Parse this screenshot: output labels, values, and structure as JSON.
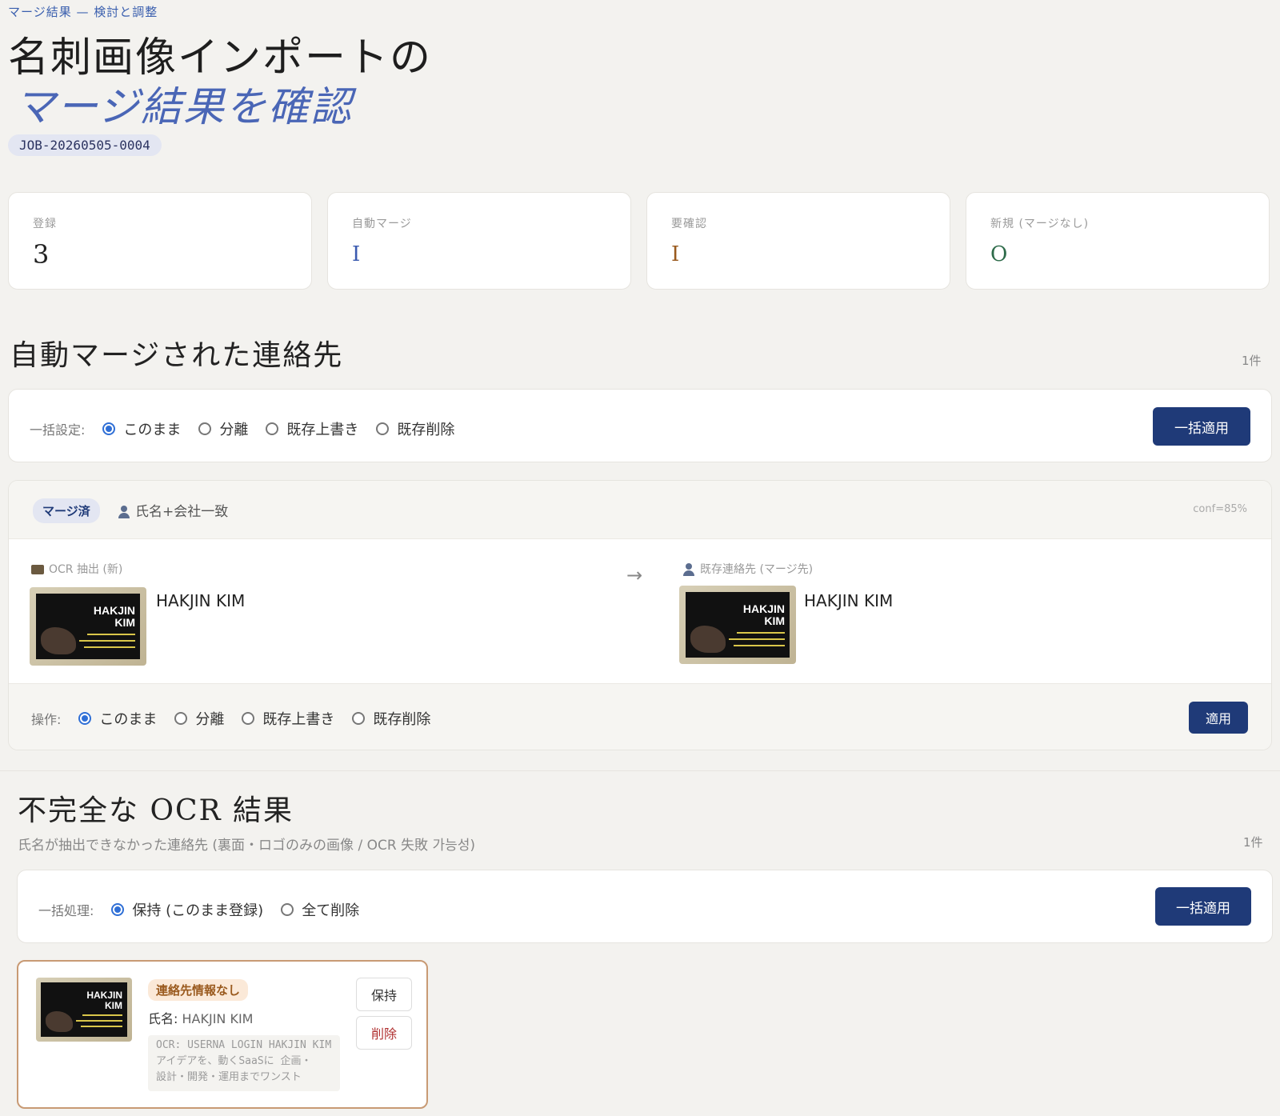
{
  "header": {
    "breadcrumb": "マージ結果 — 検討と調整",
    "title_line1": "名刺画像インポートの",
    "title_line2": "マージ結果を確認",
    "job_id": "JOB-20260505-0004"
  },
  "stats": [
    {
      "label": "登録",
      "value": "3",
      "color": "#222222"
    },
    {
      "label": "自動マージ",
      "value": "I",
      "color": "#3b5bb0"
    },
    {
      "label": "要確認",
      "value": "I",
      "color": "#9a5a1e"
    },
    {
      "label": "新規 (マージなし)",
      "value": "O",
      "color": "#2e6b4a"
    }
  ],
  "auto_merge": {
    "title": "自動マージされた連絡先",
    "count": "1件",
    "bulk": {
      "label": "一括設定:",
      "options": [
        "このまま",
        "分離",
        "既存上書き",
        "既存削除"
      ],
      "selected": "このまま",
      "button": "一括適用"
    },
    "item": {
      "status": "マージ済",
      "match_reason": "氏名+会社一致",
      "confidence": "conf=85%",
      "left_label": "OCR 抽出 (新)",
      "left_name": "HAKJIN KIM",
      "arrow": "→",
      "right_label": "既存連絡先 (マージ先)",
      "right_name": "HAKJIN KIM",
      "card_text": "HAKJIN KIM",
      "action": {
        "label": "操作:",
        "options": [
          "このまま",
          "分離",
          "既存上書き",
          "既存削除"
        ],
        "selected": "このまま",
        "button": "適用"
      }
    }
  },
  "incomplete": {
    "title": "不完全な OCR 結果",
    "subtitle": "氏名が抽出できなかった連絡先 (裏面・ロゴのみの画像 / OCR 失敗 가능성)",
    "count": "1件",
    "bulk": {
      "label": "一括処理:",
      "options": [
        "保持 (このまま登録)",
        "全て削除"
      ],
      "selected": "保持 (このまま登録)",
      "button": "一括適用"
    },
    "item": {
      "badge": "連絡先情報なし",
      "name_label": "氏名:",
      "name_value": "HAKJIN KIM",
      "ocr_lines": [
        "OCR: USERNA LOGIN HAKJIN KIM",
        "アイデアを、動くSaaSに 企画・",
        "設計・開発・運用までワンスト"
      ],
      "card_text": "HAKJIN KIM",
      "keep_button": "保持",
      "delete_button": "削除"
    }
  }
}
